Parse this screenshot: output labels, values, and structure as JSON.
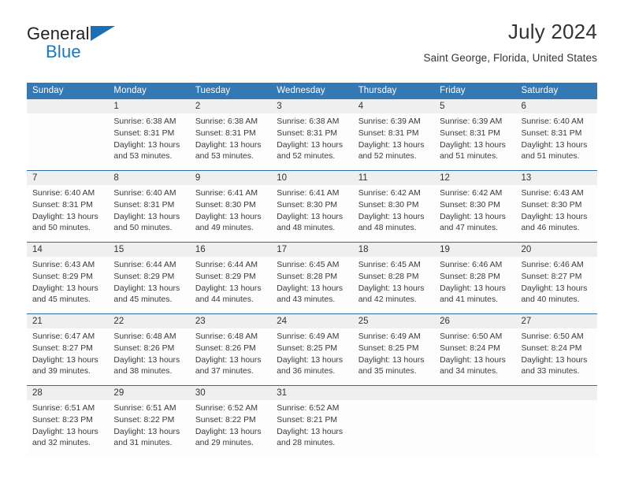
{
  "brand": {
    "name_part1": "General",
    "name_part2": "Blue",
    "triangle_color": "#1a6fb5"
  },
  "header": {
    "title": "July 2024",
    "subtitle": "Saint George, Florida, United States",
    "header_bg": "#3478b4",
    "separator_color": "#2e6da4",
    "daynum_bg": "#efefef"
  },
  "weekday_headers": [
    "Sunday",
    "Monday",
    "Tuesday",
    "Wednesday",
    "Thursday",
    "Friday",
    "Saturday"
  ],
  "weeks": [
    [
      {
        "day": "",
        "sunrise": "",
        "sunset": "",
        "daylight": ""
      },
      {
        "day": "1",
        "sunrise": "Sunrise: 6:38 AM",
        "sunset": "Sunset: 8:31 PM",
        "daylight": "Daylight: 13 hours and 53 minutes."
      },
      {
        "day": "2",
        "sunrise": "Sunrise: 6:38 AM",
        "sunset": "Sunset: 8:31 PM",
        "daylight": "Daylight: 13 hours and 53 minutes."
      },
      {
        "day": "3",
        "sunrise": "Sunrise: 6:38 AM",
        "sunset": "Sunset: 8:31 PM",
        "daylight": "Daylight: 13 hours and 52 minutes."
      },
      {
        "day": "4",
        "sunrise": "Sunrise: 6:39 AM",
        "sunset": "Sunset: 8:31 PM",
        "daylight": "Daylight: 13 hours and 52 minutes."
      },
      {
        "day": "5",
        "sunrise": "Sunrise: 6:39 AM",
        "sunset": "Sunset: 8:31 PM",
        "daylight": "Daylight: 13 hours and 51 minutes."
      },
      {
        "day": "6",
        "sunrise": "Sunrise: 6:40 AM",
        "sunset": "Sunset: 8:31 PM",
        "daylight": "Daylight: 13 hours and 51 minutes."
      }
    ],
    [
      {
        "day": "7",
        "sunrise": "Sunrise: 6:40 AM",
        "sunset": "Sunset: 8:31 PM",
        "daylight": "Daylight: 13 hours and 50 minutes."
      },
      {
        "day": "8",
        "sunrise": "Sunrise: 6:40 AM",
        "sunset": "Sunset: 8:31 PM",
        "daylight": "Daylight: 13 hours and 50 minutes."
      },
      {
        "day": "9",
        "sunrise": "Sunrise: 6:41 AM",
        "sunset": "Sunset: 8:30 PM",
        "daylight": "Daylight: 13 hours and 49 minutes."
      },
      {
        "day": "10",
        "sunrise": "Sunrise: 6:41 AM",
        "sunset": "Sunset: 8:30 PM",
        "daylight": "Daylight: 13 hours and 48 minutes."
      },
      {
        "day": "11",
        "sunrise": "Sunrise: 6:42 AM",
        "sunset": "Sunset: 8:30 PM",
        "daylight": "Daylight: 13 hours and 48 minutes."
      },
      {
        "day": "12",
        "sunrise": "Sunrise: 6:42 AM",
        "sunset": "Sunset: 8:30 PM",
        "daylight": "Daylight: 13 hours and 47 minutes."
      },
      {
        "day": "13",
        "sunrise": "Sunrise: 6:43 AM",
        "sunset": "Sunset: 8:30 PM",
        "daylight": "Daylight: 13 hours and 46 minutes."
      }
    ],
    [
      {
        "day": "14",
        "sunrise": "Sunrise: 6:43 AM",
        "sunset": "Sunset: 8:29 PM",
        "daylight": "Daylight: 13 hours and 45 minutes."
      },
      {
        "day": "15",
        "sunrise": "Sunrise: 6:44 AM",
        "sunset": "Sunset: 8:29 PM",
        "daylight": "Daylight: 13 hours and 45 minutes."
      },
      {
        "day": "16",
        "sunrise": "Sunrise: 6:44 AM",
        "sunset": "Sunset: 8:29 PM",
        "daylight": "Daylight: 13 hours and 44 minutes."
      },
      {
        "day": "17",
        "sunrise": "Sunrise: 6:45 AM",
        "sunset": "Sunset: 8:28 PM",
        "daylight": "Daylight: 13 hours and 43 minutes."
      },
      {
        "day": "18",
        "sunrise": "Sunrise: 6:45 AM",
        "sunset": "Sunset: 8:28 PM",
        "daylight": "Daylight: 13 hours and 42 minutes."
      },
      {
        "day": "19",
        "sunrise": "Sunrise: 6:46 AM",
        "sunset": "Sunset: 8:28 PM",
        "daylight": "Daylight: 13 hours and 41 minutes."
      },
      {
        "day": "20",
        "sunrise": "Sunrise: 6:46 AM",
        "sunset": "Sunset: 8:27 PM",
        "daylight": "Daylight: 13 hours and 40 minutes."
      }
    ],
    [
      {
        "day": "21",
        "sunrise": "Sunrise: 6:47 AM",
        "sunset": "Sunset: 8:27 PM",
        "daylight": "Daylight: 13 hours and 39 minutes."
      },
      {
        "day": "22",
        "sunrise": "Sunrise: 6:48 AM",
        "sunset": "Sunset: 8:26 PM",
        "daylight": "Daylight: 13 hours and 38 minutes."
      },
      {
        "day": "23",
        "sunrise": "Sunrise: 6:48 AM",
        "sunset": "Sunset: 8:26 PM",
        "daylight": "Daylight: 13 hours and 37 minutes."
      },
      {
        "day": "24",
        "sunrise": "Sunrise: 6:49 AM",
        "sunset": "Sunset: 8:25 PM",
        "daylight": "Daylight: 13 hours and 36 minutes."
      },
      {
        "day": "25",
        "sunrise": "Sunrise: 6:49 AM",
        "sunset": "Sunset: 8:25 PM",
        "daylight": "Daylight: 13 hours and 35 minutes."
      },
      {
        "day": "26",
        "sunrise": "Sunrise: 6:50 AM",
        "sunset": "Sunset: 8:24 PM",
        "daylight": "Daylight: 13 hours and 34 minutes."
      },
      {
        "day": "27",
        "sunrise": "Sunrise: 6:50 AM",
        "sunset": "Sunset: 8:24 PM",
        "daylight": "Daylight: 13 hours and 33 minutes."
      }
    ],
    [
      {
        "day": "28",
        "sunrise": "Sunrise: 6:51 AM",
        "sunset": "Sunset: 8:23 PM",
        "daylight": "Daylight: 13 hours and 32 minutes."
      },
      {
        "day": "29",
        "sunrise": "Sunrise: 6:51 AM",
        "sunset": "Sunset: 8:22 PM",
        "daylight": "Daylight: 13 hours and 31 minutes."
      },
      {
        "day": "30",
        "sunrise": "Sunrise: 6:52 AM",
        "sunset": "Sunset: 8:22 PM",
        "daylight": "Daylight: 13 hours and 29 minutes."
      },
      {
        "day": "31",
        "sunrise": "Sunrise: 6:52 AM",
        "sunset": "Sunset: 8:21 PM",
        "daylight": "Daylight: 13 hours and 28 minutes."
      },
      {
        "day": "",
        "sunrise": "",
        "sunset": "",
        "daylight": ""
      },
      {
        "day": "",
        "sunrise": "",
        "sunset": "",
        "daylight": ""
      },
      {
        "day": "",
        "sunrise": "",
        "sunset": "",
        "daylight": ""
      }
    ]
  ]
}
